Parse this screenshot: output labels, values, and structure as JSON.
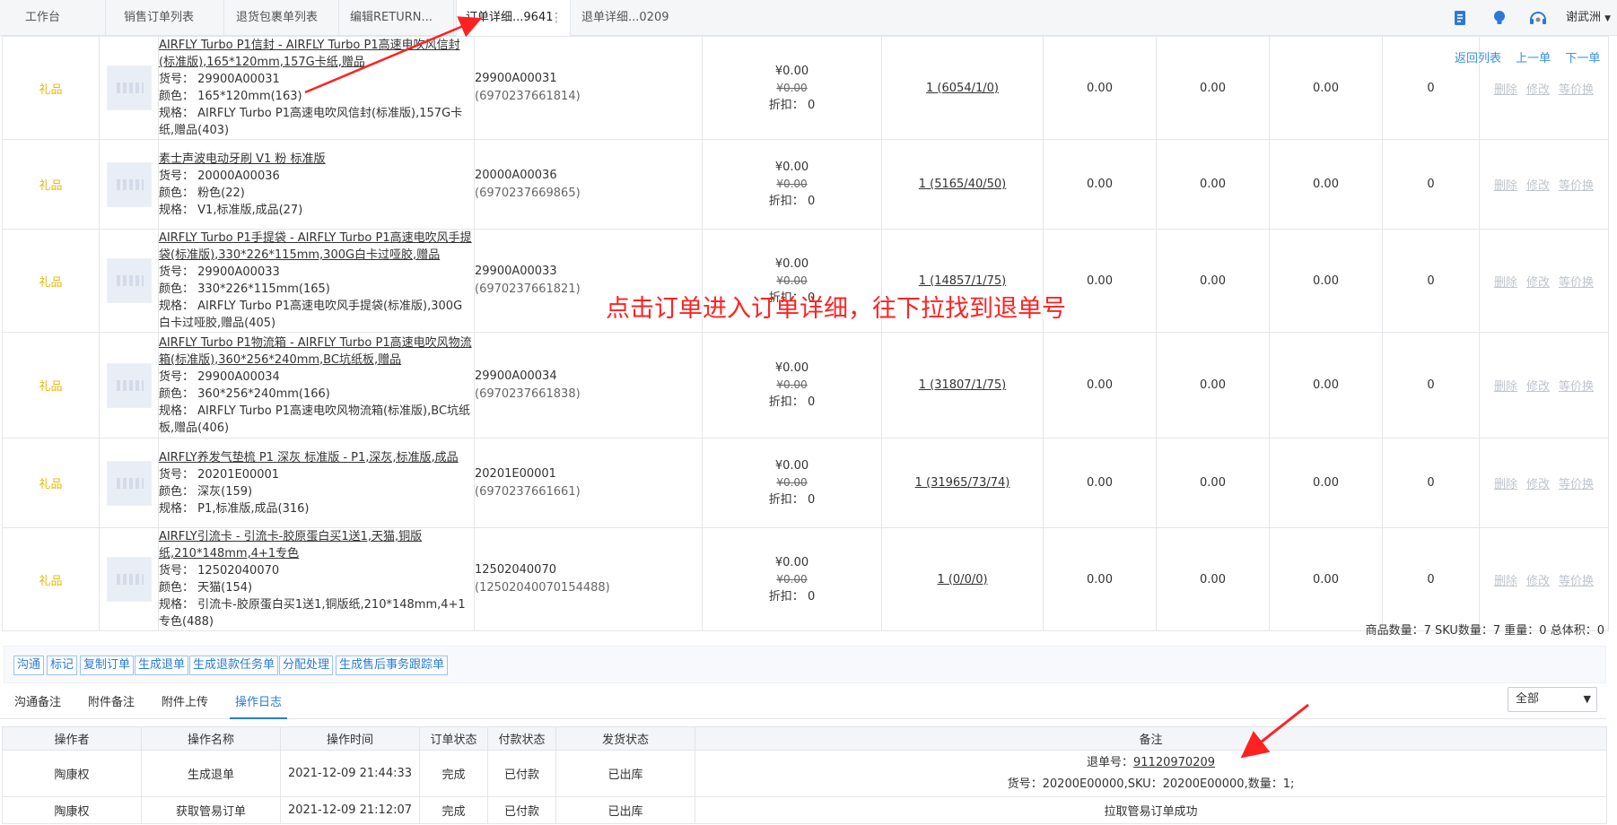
{
  "topbar": {
    "tabs": [
      {
        "label": "工作台"
      },
      {
        "label": "销售订单列表"
      },
      {
        "label": "退货包裹单列表"
      },
      {
        "label": "编辑RETURN..."
      },
      {
        "label": "订单详细...9641"
      },
      {
        "label": "退单详细...0209"
      }
    ],
    "more_glyph": "⋮",
    "icons": [
      "book-icon",
      "bulb-icon",
      "headset-icon"
    ],
    "username": "谢武洲"
  },
  "nav": {
    "back": "返回列表",
    "prev": "上一单",
    "next": "下一单"
  },
  "labels": {
    "sku_prefix": "货号：",
    "color_prefix": "颜色：",
    "spec_prefix": "规格：",
    "discount_prefix": "折扣：",
    "delete": "删除",
    "edit": "修改",
    "exchange": "等价换"
  },
  "products": [
    {
      "tag": "礼品",
      "name": "AIRFLY Turbo P1信封 - AIRFLY Turbo P1高速电吹风信封(标准版),165*120mm,157G卡纸,赠品",
      "sku": "29900A00031",
      "color": "165*120mm(163)",
      "spec": "AIRFLY Turbo P1高速电吹风信封(标准版),157G卡纸,赠品(403)",
      "code": "29900A00031",
      "ean": "(6970237661814)",
      "price": "¥0.00",
      "old_price": "¥0.00",
      "discount": "0",
      "stock": "1 (6054/1/0)",
      "v1": "0.00",
      "v2": "0.00",
      "v3": "0.00",
      "v4": "0"
    },
    {
      "tag": "礼品",
      "name": "素士声波电动牙刷 V1 粉 标准版",
      "sku": "20000A00036",
      "color": "粉色(22)",
      "spec": "V1,标准版,成品(27)",
      "code": "20000A00036",
      "ean": "(6970237669865)",
      "price": "¥0.00",
      "old_price": "¥0.00",
      "discount": "0",
      "stock": "1 (5165/40/50)",
      "v1": "0.00",
      "v2": "0.00",
      "v3": "0.00",
      "v4": "0"
    },
    {
      "tag": "礼品",
      "name": "AIRFLY Turbo P1手提袋 - AIRFLY Turbo P1高速电吹风手提袋(标准版),330*226*115mm,300G白卡过哑胶,赠品",
      "sku": "29900A00033",
      "color": "330*226*115mm(165)",
      "spec": "AIRFLY Turbo P1高速电吹风手提袋(标准版),300G白卡过哑胶,赠品(405)",
      "code": "29900A00033",
      "ean": "(6970237661821)",
      "price": "¥0.00",
      "old_price": "¥0.00",
      "discount": "0",
      "stock": "1 (14857/1/75)",
      "v1": "0.00",
      "v2": "0.00",
      "v3": "0.00",
      "v4": "0"
    },
    {
      "tag": "礼品",
      "name": "AIRFLY Turbo P1物流箱 - AIRFLY Turbo P1高速电吹风物流箱(标准版),360*256*240mm,BC坑纸板,赠品",
      "sku": "29900A00034",
      "color": "360*256*240mm(166)",
      "spec": "AIRFLY Turbo P1高速电吹风物流箱(标准版),BC坑纸板,赠品(406)",
      "code": "29900A00034",
      "ean": "(6970237661838)",
      "price": "¥0.00",
      "old_price": "¥0.00",
      "discount": "0",
      "stock": "1 (31807/1/75)",
      "v1": "0.00",
      "v2": "0.00",
      "v3": "0.00",
      "v4": "0"
    },
    {
      "tag": "礼品",
      "name": "AIRFLY养发气垫梳 P1 深灰 标准版 - P1,深灰,标准版,成品",
      "sku": "20201E00001",
      "color": "深灰(159)",
      "spec": "P1,标准版,成品(316)",
      "code": "20201E00001",
      "ean": "(6970237661661)",
      "price": "¥0.00",
      "old_price": "¥0.00",
      "discount": "0",
      "stock": "1 (31965/73/74)",
      "v1": "0.00",
      "v2": "0.00",
      "v3": "0.00",
      "v4": "0"
    },
    {
      "tag": "礼品",
      "name": "AIRFLY引流卡 - 引流卡-胶原蛋白买1送1,天猫,铜版纸,210*148mm,4+1专色",
      "sku": "12502040070",
      "color": "天猫(154)",
      "spec": "引流卡-胶原蛋白买1送1,铜版纸,210*148mm,4+1专色(488)",
      "code": "12502040070",
      "ean": "(12502040070154488)",
      "price": "¥0.00",
      "old_price": "¥0.00",
      "discount": "0",
      "stock": "1 (0/0/0)",
      "v1": "0.00",
      "v2": "0.00",
      "v3": "0.00",
      "v4": "0"
    }
  ],
  "annotation": "点击订单进入订单详细，往下拉找到退单号",
  "summary": "商品数量：7  SKU数量：7  重量：0  总体积：0",
  "actions": [
    "沟通",
    "标记",
    "复制订单",
    "生成退单",
    "生成退款任务单",
    "分配处理",
    "生成售后事务跟踪单"
  ],
  "subtabs": [
    "沟通备注",
    "附件备注",
    "附件上传",
    "操作日志"
  ],
  "filter": {
    "selected": "全部"
  },
  "log": {
    "headers": [
      "操作者",
      "操作名称",
      "操作时间",
      "订单状态",
      "付款状态",
      "发货状态",
      "备注"
    ],
    "rows": [
      {
        "operator": "陶康权",
        "action": "生成退单",
        "time": "2021-12-09 21:44:33",
        "order_status": "完成",
        "pay_status": "已付款",
        "ship_status": "已出库",
        "remark_prefix": "退单号：",
        "remark_link": "91120970209",
        "remark_line2": "货号：20200E00000,SKU：20200E00000,数量：1;"
      },
      {
        "operator": "陶康权",
        "action": "获取管易订单",
        "time": "2021-12-09 21:12:07",
        "order_status": "完成",
        "pay_status": "已付款",
        "ship_status": "已出库",
        "remark": "拉取管易订单成功"
      }
    ]
  },
  "colors": {
    "accent": "#2b7bd6",
    "gift": "#e6b800",
    "annotation": "#ff2222"
  }
}
